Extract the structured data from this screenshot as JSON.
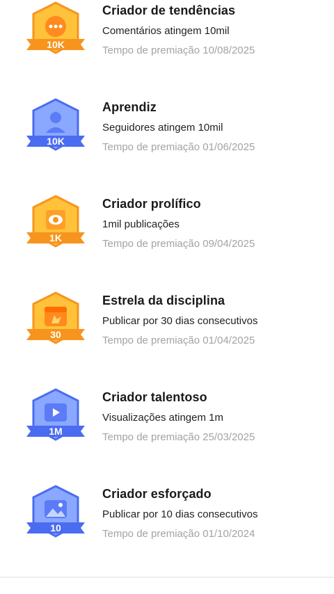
{
  "achievements": [
    {
      "badge_icon": "comment-bubble-icon",
      "badge_label": "10K",
      "theme": "gold",
      "title": "Criador de tendências",
      "description": "Comentários atingem 10mil",
      "award_time": "Tempo de premiação 10/08/2025"
    },
    {
      "badge_icon": "person-icon",
      "badge_label": "10K",
      "theme": "blue",
      "title": "Aprendiz",
      "description": "Seguidores atingem 10mil",
      "award_time": "Tempo de premiação 01/06/2025"
    },
    {
      "badge_icon": "eye-icon",
      "badge_label": "1K",
      "theme": "gold",
      "title": "Criador prolífico",
      "description": "1mil publicações",
      "award_time": "Tempo de premiação 09/04/2025"
    },
    {
      "badge_icon": "calendar-icon",
      "badge_label": "30",
      "theme": "gold",
      "title": "Estrela da disciplina",
      "description": "Publicar por 30 dias consecutivos",
      "award_time": "Tempo de premiação 01/04/2025"
    },
    {
      "badge_icon": "play-video-icon",
      "badge_label": "1M",
      "theme": "blue",
      "title": "Criador talentoso",
      "description": "Visualizações atingem 1m",
      "award_time": "Tempo de premiação 25/03/2025"
    },
    {
      "badge_icon": "photo-icon",
      "badge_label": "10",
      "theme": "blue",
      "title": "Criador esforçado",
      "description": "Publicar por 10 dias consecutivos",
      "award_time": "Tempo de premiação 01/10/2024"
    }
  ],
  "colors": {
    "gold_light": "#ffc23a",
    "gold_dark": "#f7941d",
    "blue_light": "#8aa8ff",
    "blue_dark": "#4a6cf0"
  }
}
